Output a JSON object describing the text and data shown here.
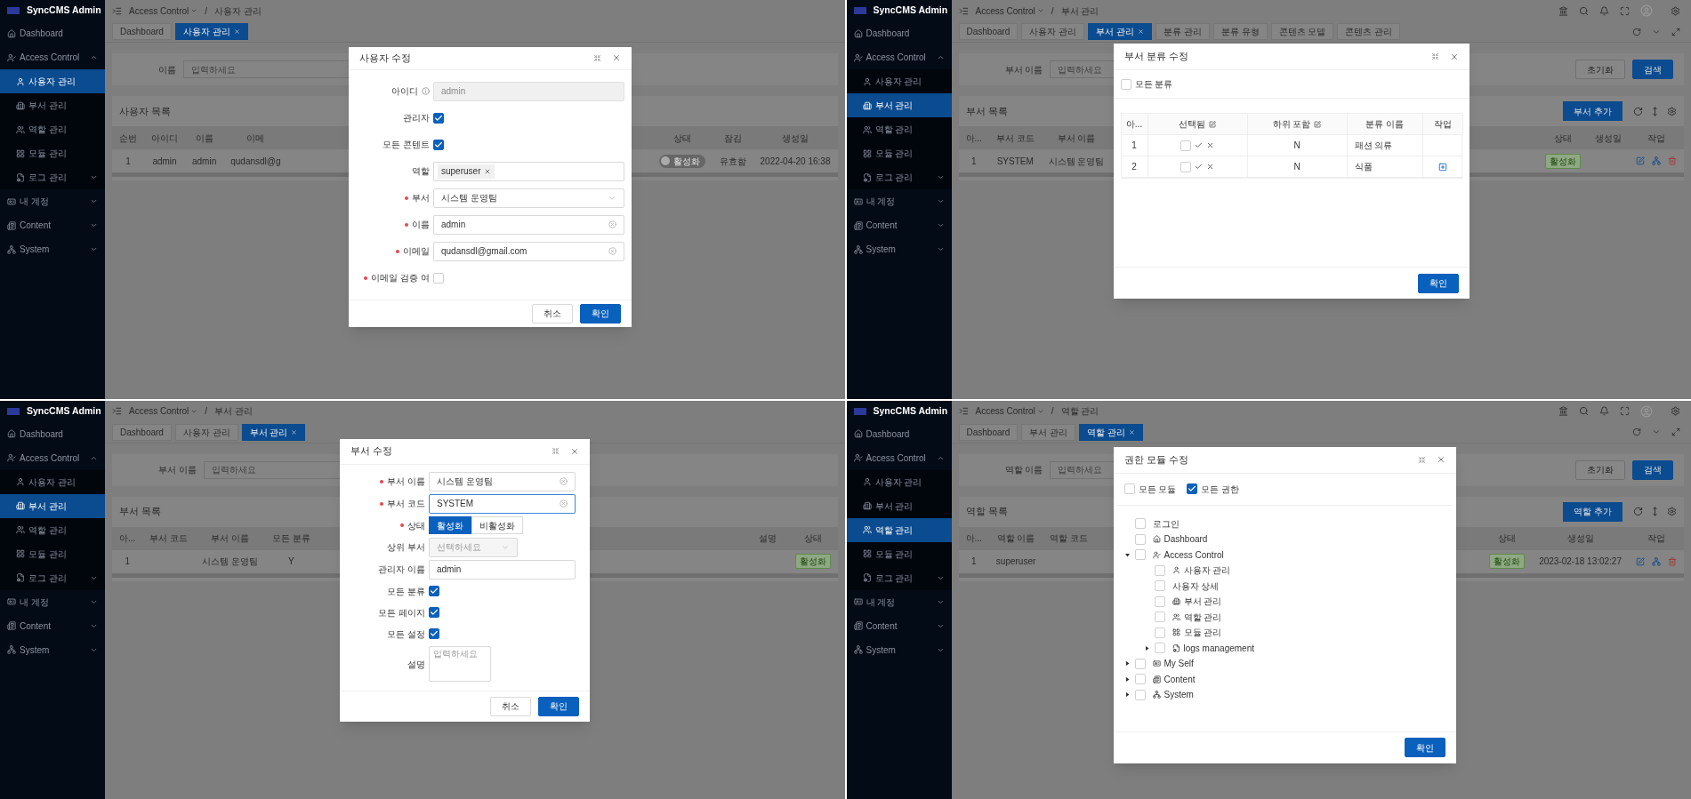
{
  "panels": [
    {
      "sidebar": {
        "brand": "SyncCMS Admin",
        "items": [
          {
            "label": "Dashboard",
            "selected": false
          },
          {
            "label": "Access Control",
            "selected": false,
            "expanded": true,
            "children": [
              {
                "label": "사용자 관리",
                "selected": true
              },
              {
                "label": "부서 관리",
                "selected": false
              },
              {
                "label": "역할 관리",
                "selected": false
              },
              {
                "label": "모듈 관리",
                "selected": false
              },
              {
                "label": "로그 관리",
                "selected": false,
                "expanded": false
              }
            ]
          },
          {
            "label": "내 계정",
            "selected": false,
            "expanded": false
          },
          {
            "label": "Content",
            "selected": false,
            "expanded": false
          },
          {
            "label": "System",
            "selected": false,
            "expanded": false
          }
        ]
      },
      "header": {
        "breadcrumb": [
          {
            "label": "Access Control",
            "dropdown": true
          },
          {
            "label": "사용자 관리",
            "dropdown": false
          }
        ],
        "separator": "/"
      },
      "tabs": [
        {
          "label": "Dashboard",
          "selected": false,
          "closable": false
        },
        {
          "label": "사용자 관리",
          "selected": true,
          "closable": true
        }
      ],
      "search": {
        "label": "이름",
        "placeholder": "입력하세요"
      },
      "list": {
        "title": "사용자 목록",
        "table": {
          "left": {
            "columns": [
              "순번",
              "아이디",
              "이름",
              "이메"
            ],
            "rows": [
              [
                "1",
                "admin",
                "admin",
                "qudansdl@g"
              ]
            ]
          },
          "right": {
            "columns": [
              "상태",
              "잠김",
              "생성일"
            ],
            "rows": [
              [
                {
                  "kind": "toggle",
                  "text": "활성화",
                  "on": false
                },
                "유효함",
                "2022-04-20 16:38"
              ]
            ]
          }
        }
      },
      "modal": {
        "title": "사용자 수정",
        "kind": "form",
        "fields": [
          {
            "kind": "input",
            "label": "아이디",
            "info": true,
            "value": "admin",
            "disabled": true
          },
          {
            "kind": "checkbox",
            "label": "관리자",
            "checked": true
          },
          {
            "kind": "checkbox",
            "label": "모든 콘텐트",
            "checked": true
          },
          {
            "kind": "tags",
            "label": "역할",
            "tags": [
              "superuser"
            ]
          },
          {
            "kind": "select",
            "label": "부서",
            "required": true,
            "value": "시스템 운영팀"
          },
          {
            "kind": "input",
            "label": "이름",
            "required": true,
            "value": "admin",
            "clearable": true
          },
          {
            "kind": "input",
            "label": "이메일",
            "required": true,
            "value": "qudansdl@gmail.com",
            "clearable": true
          },
          {
            "kind": "checkbox",
            "label": "이메일 검증 여",
            "required": true,
            "checked": false
          }
        ],
        "buttons": [
          {
            "label": "취소",
            "primary": false
          },
          {
            "label": "확인",
            "primary": true
          }
        ]
      }
    },
    {
      "sidebar": {
        "brand": "SyncCMS Admin",
        "items": [
          {
            "label": "Dashboard",
            "selected": false
          },
          {
            "label": "Access Control",
            "selected": false,
            "expanded": true,
            "children": [
              {
                "label": "사용자 관리",
                "selected": false
              },
              {
                "label": "부서 관리",
                "selected": true
              },
              {
                "label": "역할 관리",
                "selected": false
              },
              {
                "label": "모듈 관리",
                "selected": false
              },
              {
                "label": "로그 관리",
                "selected": false,
                "expanded": false
              }
            ]
          },
          {
            "label": "내 계정",
            "selected": false,
            "expanded": false
          },
          {
            "label": "Content",
            "selected": false,
            "expanded": false
          },
          {
            "label": "System",
            "selected": false,
            "expanded": false
          }
        ]
      },
      "header": {
        "breadcrumb": [
          {
            "label": "Access Control",
            "dropdown": true
          },
          {
            "label": "부서 관리",
            "dropdown": false
          }
        ],
        "separator": "/",
        "toolbar_icons": true
      },
      "tabs": [
        {
          "label": "Dashboard",
          "selected": false,
          "closable": false
        },
        {
          "label": "사용자 관리",
          "selected": false,
          "closable": false
        },
        {
          "label": "부서 관리",
          "selected": true,
          "closable": true
        },
        {
          "label": "분류 관리",
          "selected": false,
          "closable": false
        },
        {
          "label": "분류 유형",
          "selected": false,
          "closable": false
        },
        {
          "label": "콘텐츠 모델",
          "selected": false,
          "closable": false
        },
        {
          "label": "콘텐츠 관리",
          "selected": false,
          "closable": false
        }
      ],
      "tab_tools": true,
      "search": {
        "label": "부서 이름",
        "placeholder": "입력하세요",
        "buttons": [
          {
            "label": "초기화",
            "primary": false
          },
          {
            "label": "검색",
            "primary": true
          }
        ]
      },
      "list": {
        "title": "부서 목록",
        "add_button": "부서 추가",
        "tools": true,
        "table": {
          "left": {
            "columns": [
              "아...",
              "부서 코드",
              "부서 이름"
            ],
            "rows": [
              [
                "1",
                "SYSTEM",
                "시스템 운영팀"
              ]
            ]
          },
          "right": {
            "columns": [
              "상태",
              "생성일",
              "작업"
            ],
            "rows": [
              [
                {
                  "kind": "tag",
                  "text": "활성화"
                },
                null,
                {
                  "kind": "actions"
                }
              ]
            ]
          }
        }
      },
      "modal": {
        "title": "부서 분류 수정",
        "kind": "category_table",
        "checks": [
          {
            "label": "모든 분류",
            "checked": false
          }
        ],
        "columns": [
          {
            "label": "아...",
            "editable": false
          },
          {
            "label": "선택됨",
            "editable": true
          },
          {
            "label": "하위 포함",
            "editable": true
          },
          {
            "label": "분류 이름",
            "editable": false
          },
          {
            "label": "작업",
            "editable": false
          }
        ],
        "rows": [
          {
            "no": "1",
            "checked": false,
            "include": "N",
            "name": "패션 의류",
            "action": false
          },
          {
            "no": "2",
            "checked": false,
            "include": "N",
            "name": "식품",
            "action": true
          }
        ],
        "buttons": [
          {
            "label": "확인",
            "primary": true
          }
        ]
      }
    },
    {
      "sidebar": {
        "brand": "SyncCMS Admin",
        "items": [
          {
            "label": "Dashboard",
            "selected": false
          },
          {
            "label": "Access Control",
            "selected": false,
            "expanded": true,
            "children": [
              {
                "label": "사용자 관리",
                "selected": false
              },
              {
                "label": "부서 관리",
                "selected": true
              },
              {
                "label": "역할 관리",
                "selected": false
              },
              {
                "label": "모듈 관리",
                "selected": false
              },
              {
                "label": "로그 관리",
                "selected": false,
                "expanded": false
              }
            ]
          },
          {
            "label": "내 계정",
            "selected": false,
            "expanded": false
          },
          {
            "label": "Content",
            "selected": false,
            "expanded": false
          },
          {
            "label": "System",
            "selected": false,
            "expanded": false
          }
        ]
      },
      "header": {
        "breadcrumb": [
          {
            "label": "Access Control",
            "dropdown": true
          },
          {
            "label": "부서 관리",
            "dropdown": false
          }
        ],
        "separator": "/"
      },
      "tabs": [
        {
          "label": "Dashboard",
          "selected": false,
          "closable": false
        },
        {
          "label": "사용자 관리",
          "selected": false,
          "closable": false
        },
        {
          "label": "부서 관리",
          "selected": true,
          "closable": true
        }
      ],
      "search": {
        "label": "부서 이름",
        "placeholder": "입력하세요"
      },
      "list": {
        "title": "부서 목록",
        "table": {
          "left": {
            "columns": [
              "아...",
              "부서 코드",
              "부서 이름",
              "모든 분류"
            ],
            "rows": [
              [
                "1",
                null,
                "시스템 운영팀",
                "Y"
              ]
            ]
          },
          "right": {
            "columns": [
              "설명",
              "상태"
            ],
            "rows": [
              [
                null,
                {
                  "kind": "tag",
                  "text": "활성화"
                }
              ]
            ]
          }
        }
      },
      "modal": {
        "title": "부서 수정",
        "kind": "form",
        "fields": [
          {
            "kind": "input",
            "label": "부서 이름",
            "required": true,
            "value": "시스템 운영팀",
            "clearable": true
          },
          {
            "kind": "input",
            "label": "부서 코드",
            "required": true,
            "value": "SYSTEM",
            "clearable": true,
            "focused": true
          },
          {
            "kind": "radio",
            "label": "상태",
            "required": true,
            "options": [
              {
                "label": "활성화",
                "selected": true
              },
              {
                "label": "비활성화",
                "selected": false
              }
            ]
          },
          {
            "kind": "select",
            "label": "상위 부서",
            "placeholder": "선택하세요",
            "disabled": true
          },
          {
            "kind": "input",
            "label": "관리자 이름",
            "value": "admin"
          },
          {
            "kind": "checkbox",
            "label": "모든 분류",
            "checked": true
          },
          {
            "kind": "checkbox",
            "label": "모든 페이지",
            "checked": true
          },
          {
            "kind": "checkbox",
            "label": "모든 설정",
            "checked": true
          },
          {
            "kind": "textarea",
            "label": "설명",
            "placeholder": "입력하세요"
          }
        ],
        "buttons": [
          {
            "label": "취소",
            "primary": false
          },
          {
            "label": "확인",
            "primary": true
          }
        ]
      }
    },
    {
      "sidebar": {
        "brand": "SyncCMS Admin",
        "items": [
          {
            "label": "Dashboard",
            "selected": false
          },
          {
            "label": "Access Control",
            "selected": false,
            "expanded": true,
            "children": [
              {
                "label": "사용자 관리",
                "selected": false
              },
              {
                "label": "부서 관리",
                "selected": false
              },
              {
                "label": "역할 관리",
                "selected": true
              },
              {
                "label": "모듈 관리",
                "selected": false
              },
              {
                "label": "로그 관리",
                "selected": false,
                "expanded": false
              }
            ]
          },
          {
            "label": "내 계정",
            "selected": false,
            "expanded": false
          },
          {
            "label": "Content",
            "selected": false,
            "expanded": false
          },
          {
            "label": "System",
            "selected": false,
            "expanded": false
          }
        ]
      },
      "header": {
        "breadcrumb": [
          {
            "label": "Access Control",
            "dropdown": true
          },
          {
            "label": "역할 관리",
            "dropdown": false
          }
        ],
        "separator": "/",
        "toolbar_icons": true
      },
      "tabs": [
        {
          "label": "Dashboard",
          "selected": false,
          "closable": false
        },
        {
          "label": "부서 관리",
          "selected": false,
          "closable": false
        },
        {
          "label": "역할 관리",
          "selected": true,
          "closable": true
        }
      ],
      "tab_tools": true,
      "search": {
        "label": "역할 이름",
        "placeholder": "입력하세요",
        "buttons": [
          {
            "label": "초기화",
            "primary": false
          },
          {
            "label": "검색",
            "primary": true
          }
        ]
      },
      "list": {
        "title": "역할 목록",
        "add_button": "역할 추가",
        "tools": true,
        "table": {
          "left": {
            "columns": [
              "아...",
              "역할 이름",
              "역할 코드"
            ],
            "rows": [
              [
                "1",
                "superuser",
                null
              ]
            ]
          },
          "right": {
            "columns": [
              "상태",
              "생성일",
              "작업"
            ],
            "rows": [
              [
                {
                  "kind": "tag",
                  "text": "활성화"
                },
                "2023-02-18 13:02:27",
                {
                  "kind": "actions"
                }
              ]
            ]
          }
        }
      },
      "modal": {
        "title": "권한 모듈 수정",
        "kind": "tree",
        "checks": [
          {
            "label": "모든 모듈",
            "checked": false
          },
          {
            "label": "모든 권한",
            "checked": true
          }
        ],
        "tree": [
          {
            "label": "로그인",
            "checked": false
          },
          {
            "label": "Dashboard",
            "checked": false
          },
          {
            "label": "Access Control",
            "checked": false,
            "expanded": true,
            "children": [
              {
                "label": "사용자 관리",
                "checked": false
              },
              {
                "label": "사용자 상세",
                "checked": false
              },
              {
                "label": "부서 관리",
                "checked": false
              },
              {
                "label": "역할 관리",
                "checked": false
              },
              {
                "label": "모듈 관리",
                "checked": false
              },
              {
                "label": "logs management",
                "checked": false,
                "expanded": false
              }
            ]
          },
          {
            "label": "My Self",
            "checked": false,
            "expanded": false
          },
          {
            "label": "Content",
            "checked": false,
            "expanded": false
          },
          {
            "label": "System",
            "checked": false,
            "expanded": false
          }
        ],
        "buttons": [
          {
            "label": "확인",
            "primary": true
          }
        ]
      }
    }
  ]
}
